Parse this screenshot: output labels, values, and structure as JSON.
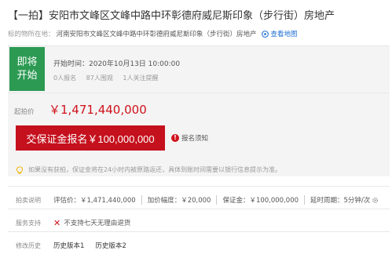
{
  "title": "【一拍】安阳市文峰区文峰中路中环彰德府威尼斯印象（步行街）房地产",
  "location": {
    "label": "标的物所在地：",
    "address": "河南安阳市文峰区文峰中路中环彰德府威尼斯印象（步行街）房地产",
    "map_link": "查看地图"
  },
  "status": {
    "badge": "即将开始",
    "start_time": "开始时间：2020年10月13日 10:00:00",
    "stats": [
      "0人报名",
      "87人围观",
      "1人关注提醒"
    ]
  },
  "price": {
    "label": "起拍价",
    "value": "￥1,471,440,000"
  },
  "actions": {
    "pay_button": "交保证金报名￥100,000,000",
    "notice_link": "报名须知"
  },
  "tip": "如果没有获拍，保证金将在24小时内被原路返还，具体到账时间需要以银行信息提示为准。",
  "rules": {
    "label": "拍卖说明",
    "items": [
      "评估价：￥1,471,440,000",
      "加价幅度：￥20,000",
      "保证金：￥100,000,000",
      "延时周期：5分钟/次"
    ]
  },
  "service": {
    "label": "服务支持",
    "text": "不支持七天无理由退货"
  },
  "history": {
    "label": "修改历史",
    "items": [
      "历史版本1",
      "历史版本2"
    ]
  },
  "colors": {
    "accent_red": "#c5101d",
    "badge_green": "#2c9a53",
    "link_blue": "#1f6fd1"
  }
}
